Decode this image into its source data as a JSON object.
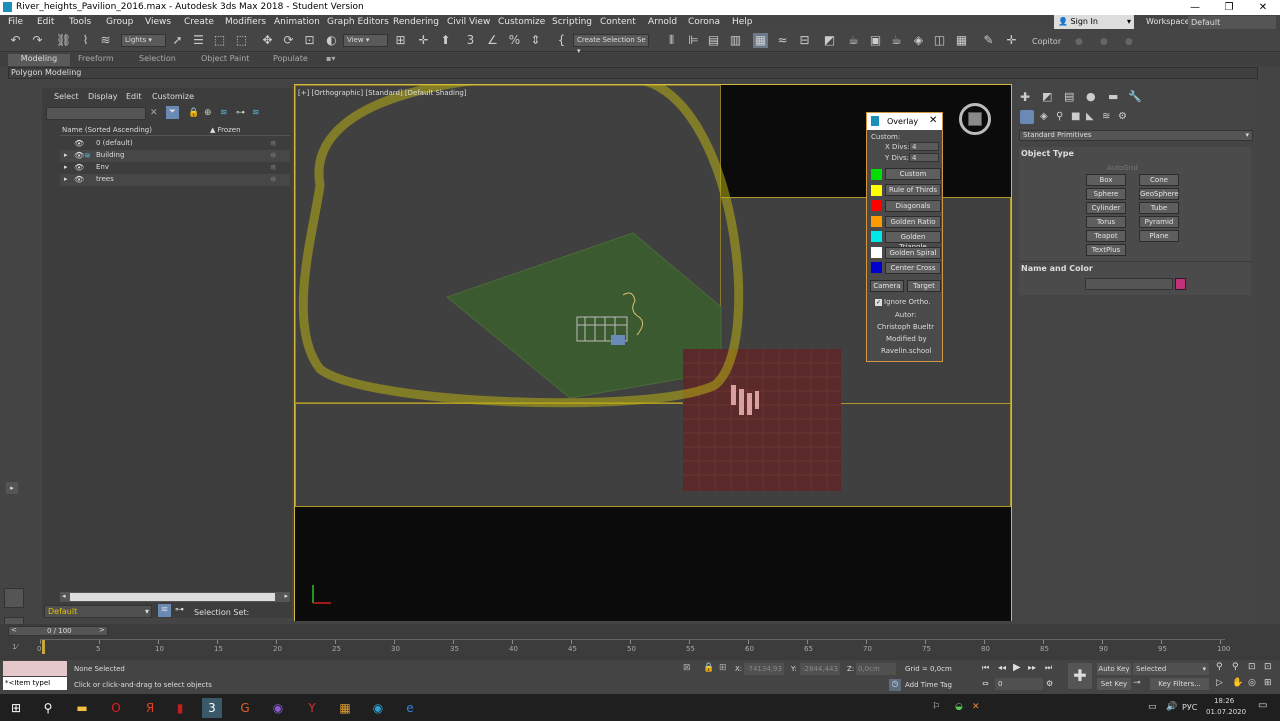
{
  "window": {
    "title": "River_heights_Pavilion_2016.max - Autodesk 3ds Max 2018 - Student Version"
  },
  "menu": [
    "File",
    "Edit",
    "Tools",
    "Group",
    "Views",
    "Create",
    "Modifiers",
    "Animation",
    "Graph Editors",
    "Rendering",
    "Civil View",
    "Customize",
    "Scripting",
    "Content",
    "Arnold",
    "Corona",
    "Help"
  ],
  "account": {
    "sign_in": "Sign In",
    "workspaces_label": "Workspaces:",
    "workspaces_value": "Default"
  },
  "toolbar": {
    "lights": "Lights",
    "view": "View",
    "create_selection": "Create Selection Se",
    "copitor": "Copitor"
  },
  "ribbon": {
    "tabs": [
      "Modeling",
      "Freeform",
      "Selection",
      "Object Paint",
      "Populate"
    ],
    "sub": "Polygon Modeling"
  },
  "scene_explorer": {
    "menu": [
      "Select",
      "Display",
      "Edit",
      "Customize"
    ],
    "col_name": "Name (Sorted Ascending)",
    "col_frozen": "▲ Frozen",
    "items": [
      "0 (default)",
      "Building",
      "Env",
      "trees"
    ],
    "layer": "Default",
    "selection_set": "Selection Set:"
  },
  "viewport": {
    "label": "[+] [Orthographic] [Standard] [Default Shading]"
  },
  "overlay": {
    "title": "Overlay",
    "custom": "Custom:",
    "xdivs_label": "X Divs:",
    "xdivs": "4",
    "ydivs_label": "Y Divs:",
    "ydivs": "4",
    "buttons": [
      "Custom",
      "Rule of Thirds",
      "Diagonals",
      "Golden Ratio",
      "Golden Triangle",
      "Golden Spiral",
      "Center Cross"
    ],
    "colors": [
      "#00e000",
      "#ffff00",
      "#ff0000",
      "#ff9a00",
      "#00e8e8",
      "#ffffff",
      "#0000d0"
    ],
    "camera": "Camera",
    "target": "Target",
    "ignore": "Ignore Ortho.",
    "autor": "Autor:",
    "author": "Christoph Bueltr",
    "modified": "Modified by",
    "modifier": "Ravelin.school"
  },
  "command_panel": {
    "dropdown": "Standard Primitives",
    "object_type": "Object Type",
    "autogrid": "AutoGrid",
    "prims": [
      "Box",
      "Cone",
      "Sphere",
      "GeoSphere",
      "Cylinder",
      "Tube",
      "Torus",
      "Pyramid",
      "Teapot",
      "Plane",
      "TextPlus"
    ],
    "name_color": "Name and Color",
    "color": "#c2307a"
  },
  "timeline": {
    "frame": "0 / 100",
    "ticks": [
      "0",
      "5",
      "10",
      "15",
      "20",
      "25",
      "30",
      "35",
      "40",
      "45",
      "50",
      "55",
      "60",
      "65",
      "70",
      "75",
      "80",
      "85",
      "90",
      "95",
      "100"
    ]
  },
  "status": {
    "none_selected": "None Selected",
    "hint": "Click or click-and-drag to select objects",
    "script": "*<Item typeI",
    "x_label": "X:",
    "x": "-74134,93",
    "y_label": "Y:",
    "y": "-2844,443",
    "z_label": "Z:",
    "z": "0,0cm",
    "grid": "Grid = 0,0cm",
    "add_time_tag": "Add Time Tag",
    "auto_key": "Auto Key",
    "set_key": "Set Key",
    "selected": "Selected",
    "key_filters": "Key Filters...",
    "frame_input": "0"
  },
  "taskbar": {
    "lang": "РУС",
    "time": "18:26",
    "date": "01.07.2020"
  }
}
